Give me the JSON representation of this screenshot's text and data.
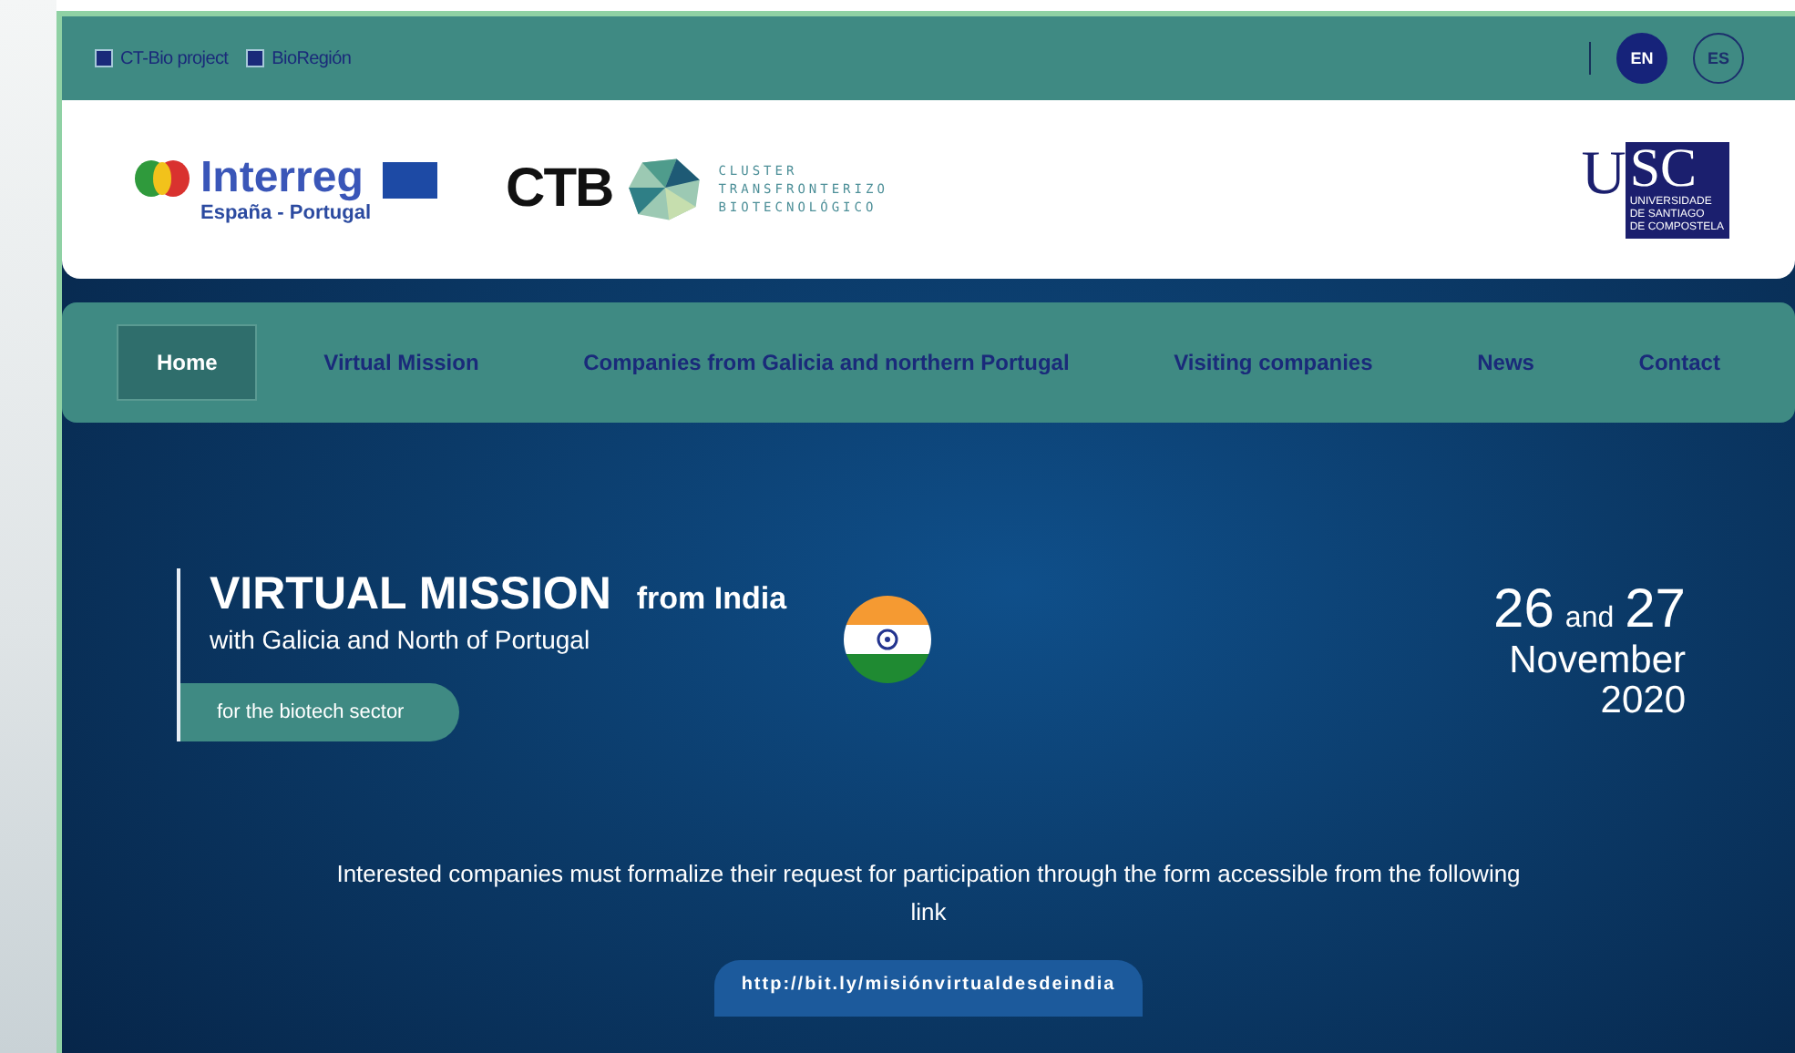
{
  "top_links": [
    {
      "label": "CT-Bio project"
    },
    {
      "label": "BioRegión"
    }
  ],
  "languages": [
    {
      "label": "EN",
      "selected": true
    },
    {
      "label": "ES",
      "selected": false
    }
  ],
  "logos": {
    "interreg": {
      "name": "Interreg",
      "subtitle": "España - Portugal"
    },
    "ctb": {
      "name": "CTB",
      "lines": [
        "CLUSTER",
        "TRANSFRONTERIZO",
        "BIOTECNOLÓGICO"
      ]
    },
    "usc": {
      "letters": [
        "U",
        "SC"
      ],
      "lines": [
        "UNIVERSIDADE",
        "DE SANTIAGO",
        "DE COMPOSTELA"
      ]
    }
  },
  "nav": [
    {
      "label": "Home",
      "selected": true
    },
    {
      "label": "Virtual Mission",
      "selected": false
    },
    {
      "label": "Companies from Galicia and northern Portugal",
      "selected": false
    },
    {
      "label": "Visiting companies",
      "selected": false
    },
    {
      "label": "News",
      "selected": false
    },
    {
      "label": "Contact",
      "selected": false
    }
  ],
  "hero": {
    "title": "VIRTUAL MISSION",
    "title_suffix": "from India",
    "subtitle": "with Galicia and North of Portugal",
    "tag": "for the biotech sector",
    "date": {
      "day1": "26",
      "joiner": "and",
      "day2": "27",
      "month": "November",
      "year": "2020"
    },
    "notice": "Interested companies must formalize their request for participation through the form accessible from the following link",
    "link": "http://bit.ly/misiónvirtualdesdeindia"
  }
}
